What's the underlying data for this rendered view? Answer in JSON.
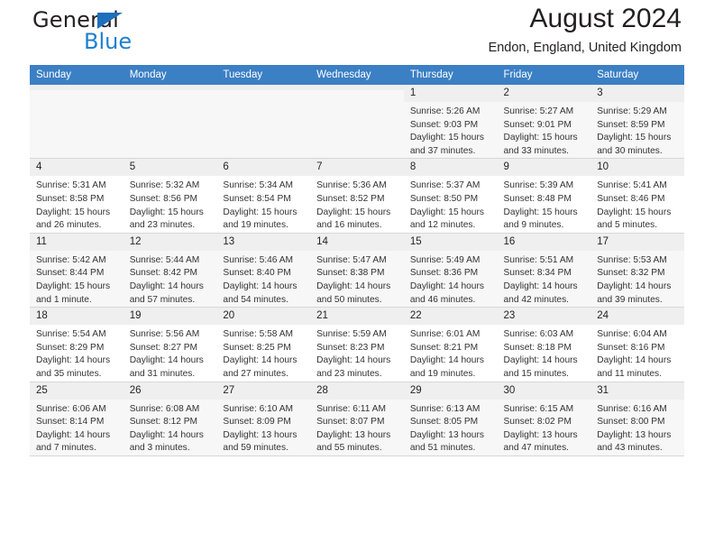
{
  "brand": {
    "name_dark": "General",
    "name_blue": "Blue",
    "accent_color": "#1f7fd0",
    "triangle_color": "#1f6fbd"
  },
  "header": {
    "title": "August 2024",
    "subtitle": "Endon, England, United Kingdom"
  },
  "calendar": {
    "header_bg": "#3b7fc4",
    "weekdays": [
      "Sunday",
      "Monday",
      "Tuesday",
      "Wednesday",
      "Thursday",
      "Friday",
      "Saturday"
    ],
    "labels": {
      "sunrise": "Sunrise:",
      "sunset": "Sunset:",
      "daylight": "Daylight:"
    },
    "weeks": [
      [
        {
          "day": "",
          "empty": true
        },
        {
          "day": "",
          "empty": true
        },
        {
          "day": "",
          "empty": true
        },
        {
          "day": "",
          "empty": true
        },
        {
          "day": "1",
          "sunrise": "Sunrise: 5:26 AM",
          "sunset": "Sunset: 9:03 PM",
          "daylight1": "Daylight: 15 hours",
          "daylight2": "and 37 minutes."
        },
        {
          "day": "2",
          "sunrise": "Sunrise: 5:27 AM",
          "sunset": "Sunset: 9:01 PM",
          "daylight1": "Daylight: 15 hours",
          "daylight2": "and 33 minutes."
        },
        {
          "day": "3",
          "sunrise": "Sunrise: 5:29 AM",
          "sunset": "Sunset: 8:59 PM",
          "daylight1": "Daylight: 15 hours",
          "daylight2": "and 30 minutes."
        }
      ],
      [
        {
          "day": "4",
          "sunrise": "Sunrise: 5:31 AM",
          "sunset": "Sunset: 8:58 PM",
          "daylight1": "Daylight: 15 hours",
          "daylight2": "and 26 minutes."
        },
        {
          "day": "5",
          "sunrise": "Sunrise: 5:32 AM",
          "sunset": "Sunset: 8:56 PM",
          "daylight1": "Daylight: 15 hours",
          "daylight2": "and 23 minutes."
        },
        {
          "day": "6",
          "sunrise": "Sunrise: 5:34 AM",
          "sunset": "Sunset: 8:54 PM",
          "daylight1": "Daylight: 15 hours",
          "daylight2": "and 19 minutes."
        },
        {
          "day": "7",
          "sunrise": "Sunrise: 5:36 AM",
          "sunset": "Sunset: 8:52 PM",
          "daylight1": "Daylight: 15 hours",
          "daylight2": "and 16 minutes."
        },
        {
          "day": "8",
          "sunrise": "Sunrise: 5:37 AM",
          "sunset": "Sunset: 8:50 PM",
          "daylight1": "Daylight: 15 hours",
          "daylight2": "and 12 minutes."
        },
        {
          "day": "9",
          "sunrise": "Sunrise: 5:39 AM",
          "sunset": "Sunset: 8:48 PM",
          "daylight1": "Daylight: 15 hours",
          "daylight2": "and 9 minutes."
        },
        {
          "day": "10",
          "sunrise": "Sunrise: 5:41 AM",
          "sunset": "Sunset: 8:46 PM",
          "daylight1": "Daylight: 15 hours",
          "daylight2": "and 5 minutes."
        }
      ],
      [
        {
          "day": "11",
          "sunrise": "Sunrise: 5:42 AM",
          "sunset": "Sunset: 8:44 PM",
          "daylight1": "Daylight: 15 hours",
          "daylight2": "and 1 minute."
        },
        {
          "day": "12",
          "sunrise": "Sunrise: 5:44 AM",
          "sunset": "Sunset: 8:42 PM",
          "daylight1": "Daylight: 14 hours",
          "daylight2": "and 57 minutes."
        },
        {
          "day": "13",
          "sunrise": "Sunrise: 5:46 AM",
          "sunset": "Sunset: 8:40 PM",
          "daylight1": "Daylight: 14 hours",
          "daylight2": "and 54 minutes."
        },
        {
          "day": "14",
          "sunrise": "Sunrise: 5:47 AM",
          "sunset": "Sunset: 8:38 PM",
          "daylight1": "Daylight: 14 hours",
          "daylight2": "and 50 minutes."
        },
        {
          "day": "15",
          "sunrise": "Sunrise: 5:49 AM",
          "sunset": "Sunset: 8:36 PM",
          "daylight1": "Daylight: 14 hours",
          "daylight2": "and 46 minutes."
        },
        {
          "day": "16",
          "sunrise": "Sunrise: 5:51 AM",
          "sunset": "Sunset: 8:34 PM",
          "daylight1": "Daylight: 14 hours",
          "daylight2": "and 42 minutes."
        },
        {
          "day": "17",
          "sunrise": "Sunrise: 5:53 AM",
          "sunset": "Sunset: 8:32 PM",
          "daylight1": "Daylight: 14 hours",
          "daylight2": "and 39 minutes."
        }
      ],
      [
        {
          "day": "18",
          "sunrise": "Sunrise: 5:54 AM",
          "sunset": "Sunset: 8:29 PM",
          "daylight1": "Daylight: 14 hours",
          "daylight2": "and 35 minutes."
        },
        {
          "day": "19",
          "sunrise": "Sunrise: 5:56 AM",
          "sunset": "Sunset: 8:27 PM",
          "daylight1": "Daylight: 14 hours",
          "daylight2": "and 31 minutes."
        },
        {
          "day": "20",
          "sunrise": "Sunrise: 5:58 AM",
          "sunset": "Sunset: 8:25 PM",
          "daylight1": "Daylight: 14 hours",
          "daylight2": "and 27 minutes."
        },
        {
          "day": "21",
          "sunrise": "Sunrise: 5:59 AM",
          "sunset": "Sunset: 8:23 PM",
          "daylight1": "Daylight: 14 hours",
          "daylight2": "and 23 minutes."
        },
        {
          "day": "22",
          "sunrise": "Sunrise: 6:01 AM",
          "sunset": "Sunset: 8:21 PM",
          "daylight1": "Daylight: 14 hours",
          "daylight2": "and 19 minutes."
        },
        {
          "day": "23",
          "sunrise": "Sunrise: 6:03 AM",
          "sunset": "Sunset: 8:18 PM",
          "daylight1": "Daylight: 14 hours",
          "daylight2": "and 15 minutes."
        },
        {
          "day": "24",
          "sunrise": "Sunrise: 6:04 AM",
          "sunset": "Sunset: 8:16 PM",
          "daylight1": "Daylight: 14 hours",
          "daylight2": "and 11 minutes."
        }
      ],
      [
        {
          "day": "25",
          "sunrise": "Sunrise: 6:06 AM",
          "sunset": "Sunset: 8:14 PM",
          "daylight1": "Daylight: 14 hours",
          "daylight2": "and 7 minutes."
        },
        {
          "day": "26",
          "sunrise": "Sunrise: 6:08 AM",
          "sunset": "Sunset: 8:12 PM",
          "daylight1": "Daylight: 14 hours",
          "daylight2": "and 3 minutes."
        },
        {
          "day": "27",
          "sunrise": "Sunrise: 6:10 AM",
          "sunset": "Sunset: 8:09 PM",
          "daylight1": "Daylight: 13 hours",
          "daylight2": "and 59 minutes."
        },
        {
          "day": "28",
          "sunrise": "Sunrise: 6:11 AM",
          "sunset": "Sunset: 8:07 PM",
          "daylight1": "Daylight: 13 hours",
          "daylight2": "and 55 minutes."
        },
        {
          "day": "29",
          "sunrise": "Sunrise: 6:13 AM",
          "sunset": "Sunset: 8:05 PM",
          "daylight1": "Daylight: 13 hours",
          "daylight2": "and 51 minutes."
        },
        {
          "day": "30",
          "sunrise": "Sunrise: 6:15 AM",
          "sunset": "Sunset: 8:02 PM",
          "daylight1": "Daylight: 13 hours",
          "daylight2": "and 47 minutes."
        },
        {
          "day": "31",
          "sunrise": "Sunrise: 6:16 AM",
          "sunset": "Sunset: 8:00 PM",
          "daylight1": "Daylight: 13 hours",
          "daylight2": "and 43 minutes."
        }
      ]
    ]
  }
}
